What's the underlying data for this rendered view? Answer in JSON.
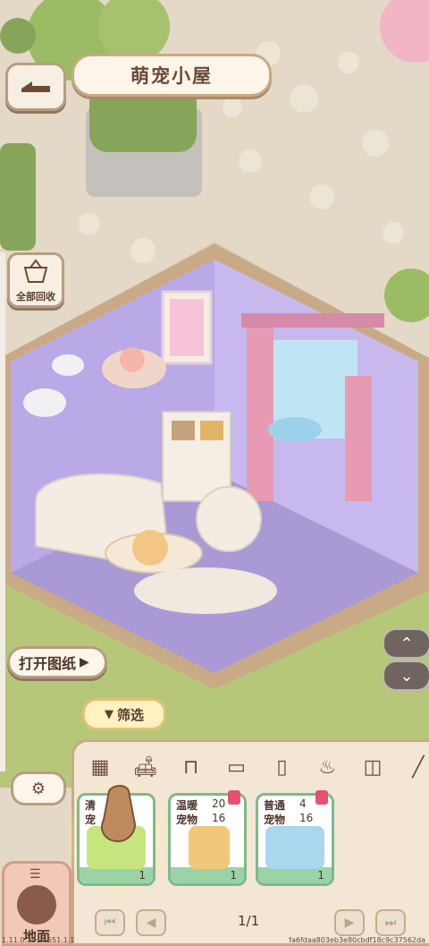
{
  "header": {
    "title": "萌宠小屋"
  },
  "left_buttons": {
    "recall_label": "全部回收",
    "blueprint_label": "打开图纸"
  },
  "filter": {
    "label": "筛选"
  },
  "categories": [
    "grid-icon",
    "sofa-icon",
    "table-icon",
    "bed-icon",
    "cabinet-icon",
    "pot-icon",
    "bathtub-icon",
    "lamp-icon"
  ],
  "cards": [
    {
      "line1": "清",
      "line2": "宠",
      "num1": "",
      "num2": "",
      "count": "1"
    },
    {
      "line1": "温暖",
      "line2": "宠物",
      "num1": "20",
      "num2": "16",
      "count": "1"
    },
    {
      "line1": "普通",
      "line2": "宠物",
      "num1": "4",
      "num2": "16",
      "count": "1"
    }
  ],
  "pager": {
    "page": "1/1"
  },
  "floor_tab": {
    "label": "地面"
  },
  "footer": {
    "version": "1.11.0.23.21651.1.1",
    "hash": "fa6fdaa803eb3e80cbdf18c9c37562da"
  },
  "colors": {
    "wall": "#b9a9e6",
    "floor": "#a99ad6",
    "frame": "#c9aa86",
    "grass": "#a8c470",
    "card_border": "#7fb98b"
  }
}
